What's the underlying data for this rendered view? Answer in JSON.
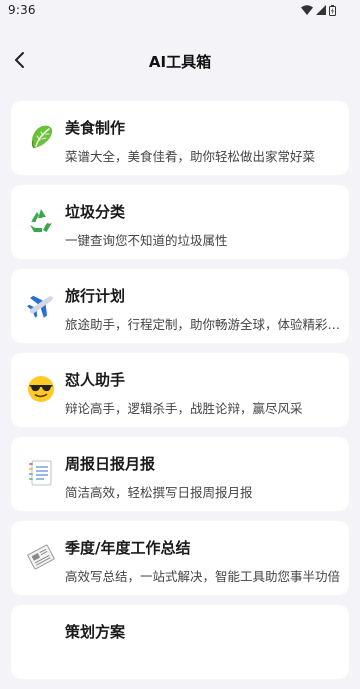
{
  "status_bar": {
    "time": "9:36"
  },
  "header": {
    "back_icon": "chevron-left-icon",
    "title": "AI工具箱"
  },
  "tools": [
    {
      "icon": "lettuce-icon",
      "title": "美食制作",
      "description": "菜谱大全，美食佳肴，助你轻松做出家常好菜"
    },
    {
      "icon": "recycle-icon",
      "title": "垃圾分类",
      "description": "一键查询您不知道的垃圾属性"
    },
    {
      "icon": "airplane-icon",
      "title": "旅行计划",
      "description": "旅途助手，行程定制，助你畅游全球，体验精彩旅程"
    },
    {
      "icon": "sunglasses-face-icon",
      "title": "怼人助手",
      "description": "辩论高手，逻辑杀手，战胜论辩，赢尽风采"
    },
    {
      "icon": "report-document-icon",
      "title": "周报日报月报",
      "description": "简洁高效，轻松撰写日报周报月报"
    },
    {
      "icon": "newspaper-icon",
      "title": "季度/年度工作总结",
      "description": "高效写总结，一站式解决，智能工具助您事半功倍"
    },
    {
      "icon": "plan-icon",
      "title": "策划方案",
      "description": ""
    }
  ],
  "colors": {
    "background": "#f3f3f8",
    "card": "#ffffff",
    "title_text": "#1a1a1a",
    "desc_text": "#444444"
  }
}
